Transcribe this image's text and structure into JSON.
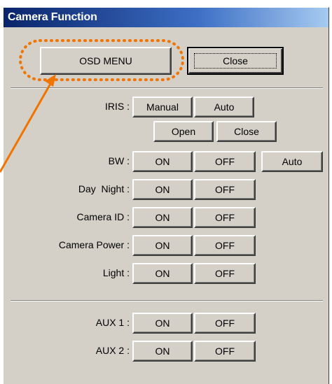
{
  "window": {
    "title": "Camera Function"
  },
  "top": {
    "osd_menu_label": "OSD MENU",
    "close_label": "Close"
  },
  "iris": {
    "label": "IRIS :",
    "manual_label": "Manual",
    "auto_label": "Auto",
    "open_label": "Open",
    "close_label": "Close"
  },
  "bw": {
    "label": "BW :",
    "on_label": "ON",
    "off_label": "OFF",
    "auto_label": "Auto"
  },
  "day_night": {
    "label": "Day  Night :",
    "on_label": "ON",
    "off_label": "OFF"
  },
  "camera_id": {
    "label": "Camera ID :",
    "on_label": "ON",
    "off_label": "OFF"
  },
  "camera_power": {
    "label": "Camera Power :",
    "on_label": "ON",
    "off_label": "OFF"
  },
  "light": {
    "label": "Light :",
    "on_label": "ON",
    "off_label": "OFF"
  },
  "aux1": {
    "label": "AUX 1 :",
    "on_label": "ON",
    "off_label": "OFF"
  },
  "aux2": {
    "label": "AUX 2 :",
    "on_label": "ON",
    "off_label": "OFF"
  },
  "colors": {
    "annotation": "#f07400",
    "dialog_face": "#d4d0c8",
    "title_start": "#0a246a"
  }
}
